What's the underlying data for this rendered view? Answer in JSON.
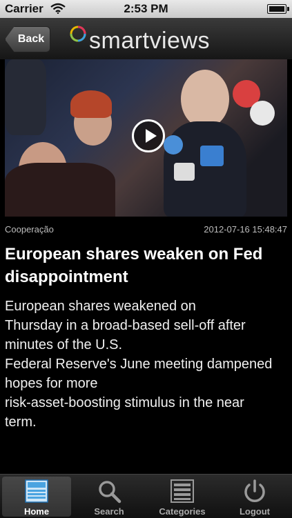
{
  "status_bar": {
    "carrier": "Carrier",
    "time": "2:53 PM"
  },
  "nav": {
    "back_label": "Back",
    "logo_text": "smartviews"
  },
  "article": {
    "category": "Cooperação",
    "datetime": "2012-07-16 15:48:47",
    "headline": "European shares weaken on Fed disappointment",
    "body_lines": [
      "European shares weakened on",
      "Thursday in a broad-based sell-off after",
      "minutes of the U.S.",
      "Federal Reserve's June meeting dampened",
      "hopes for more",
      "risk-asset-boosting stimulus in the near",
      "term."
    ]
  },
  "tabs": [
    {
      "label": "Home",
      "icon": "home-icon",
      "active": true
    },
    {
      "label": "Search",
      "icon": "search-icon",
      "active": false
    },
    {
      "label": "Categories",
      "icon": "list-icon",
      "active": false
    },
    {
      "label": "Logout",
      "icon": "power-icon",
      "active": false
    }
  ],
  "colors": {
    "tab_active": "#4aa3e0",
    "logo_ring": "#e6b800"
  }
}
